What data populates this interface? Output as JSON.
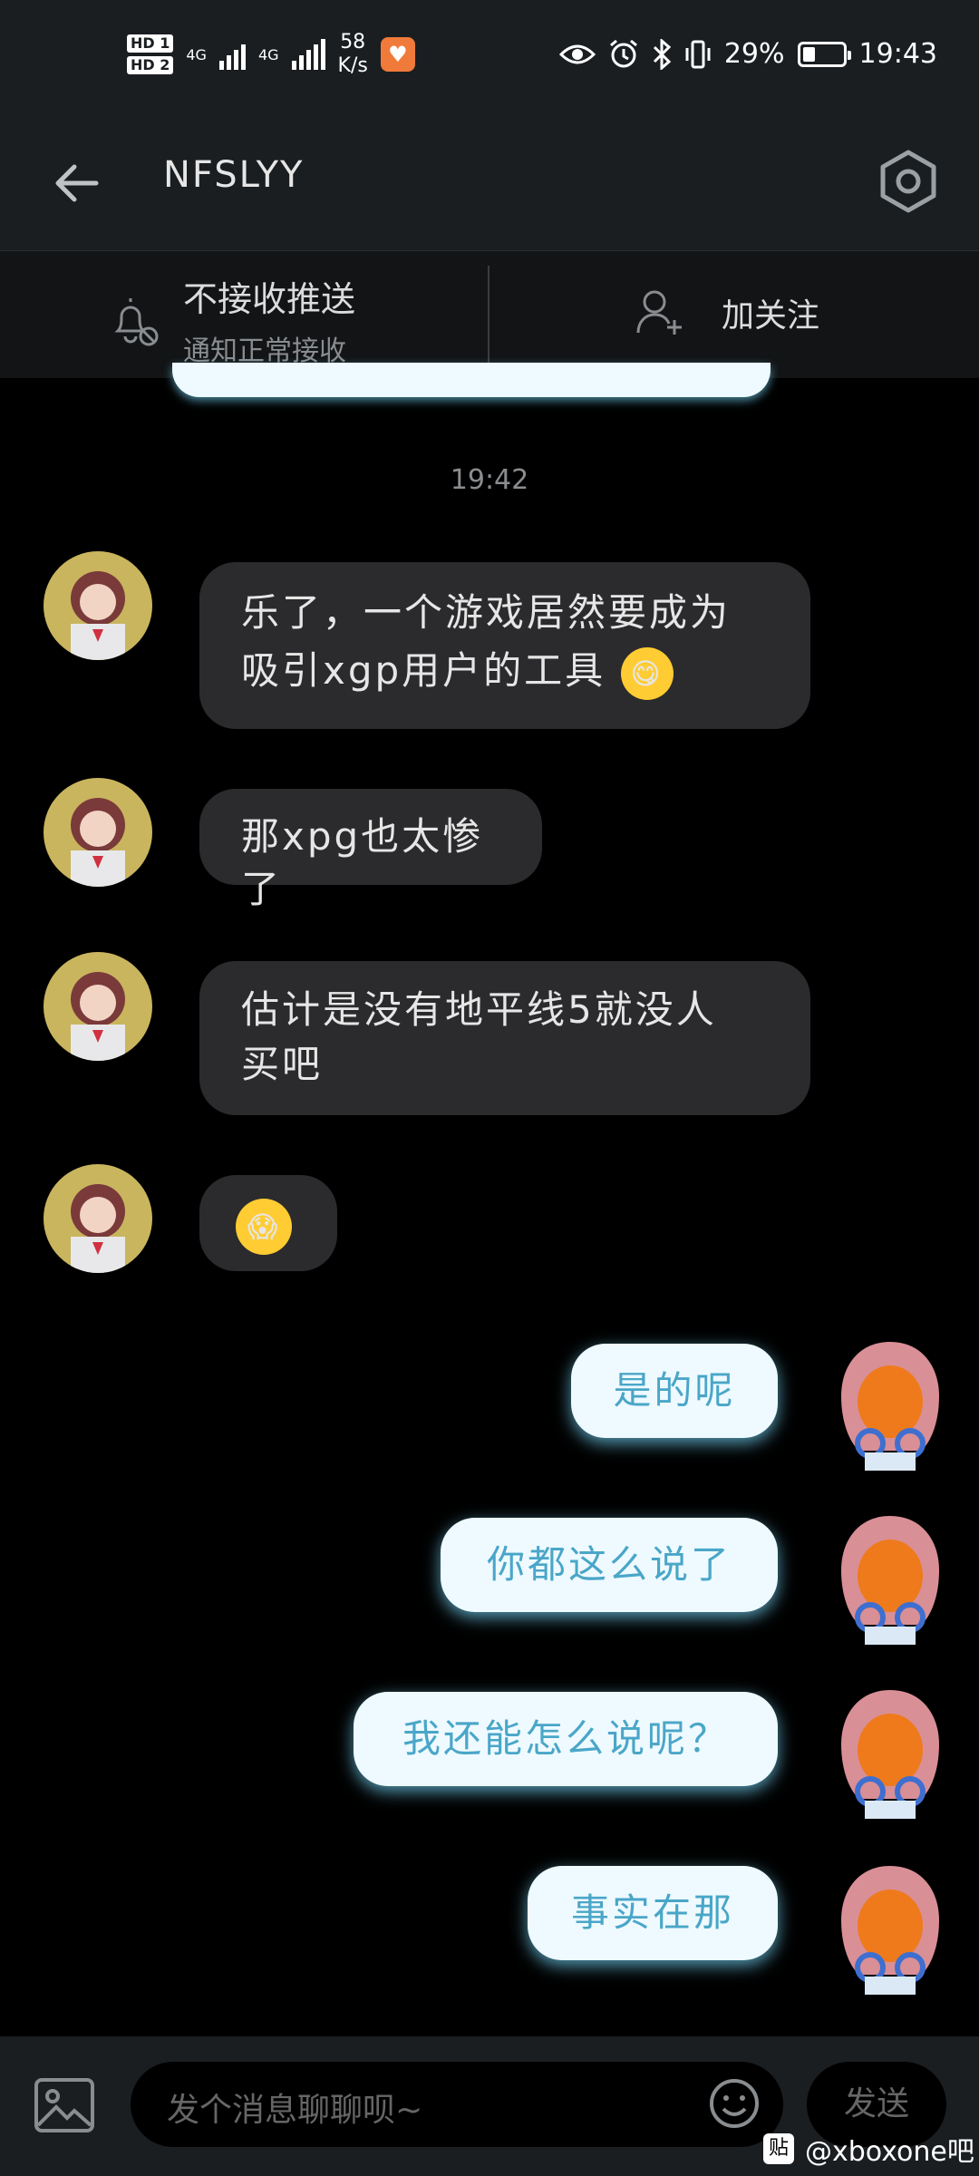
{
  "status_bar": {
    "hd1": "HD 1",
    "hd2": "HD 2",
    "net1": "4G",
    "net2": "4G",
    "speed_value": "58",
    "speed_unit": "K/s",
    "battery_percent": "29%",
    "time": "19:43"
  },
  "header": {
    "title": "NFSLYY"
  },
  "subscription": {
    "push_title": "不接收推送",
    "push_subtitle": "通知正常接收",
    "follow_label": "加关注"
  },
  "chat": {
    "timestamp": "19:42",
    "messages": [
      {
        "side": "left",
        "line1": "乐了，一个游戏居然要成为",
        "line2": "吸引xgp用户的工具"
      },
      {
        "side": "left",
        "text": "那xpg也太惨了"
      },
      {
        "side": "left",
        "line1": "估计是没有地平线5就没人",
        "line2": "买吧"
      },
      {
        "side": "left",
        "text": ""
      },
      {
        "side": "right",
        "text": "是的呢"
      },
      {
        "side": "right",
        "text": "你都这么说了"
      },
      {
        "side": "right",
        "text": "我还能怎么说呢？"
      },
      {
        "side": "right",
        "text": "事实在那"
      }
    ]
  },
  "input": {
    "placeholder": "发个消息聊聊呗~",
    "send_label": "发送"
  },
  "watermark": {
    "badge": "贴",
    "text": "@xboxone吧"
  },
  "icons": [
    "back-arrow-icon",
    "settings-hexagon-icon",
    "bell-off-icon",
    "add-user-icon",
    "image-icon",
    "smiley-icon",
    "eye-icon",
    "alarm-icon",
    "bluetooth-icon",
    "vibrate-icon",
    "battery-icon",
    "signal-icon"
  ],
  "colors": {
    "accent_bubble": "#eefaff",
    "accent_text": "#4aa6c8",
    "left_bubble": "#2b2b2d",
    "bar_bg": "#1a1e21"
  }
}
